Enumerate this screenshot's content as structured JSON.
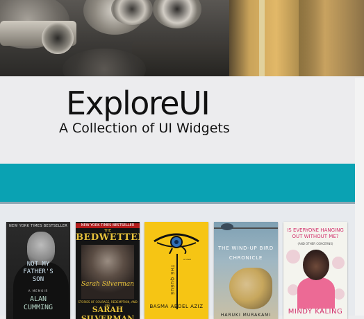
{
  "header": {
    "title": "ExploreUI",
    "subtitle": "A Collection of UI Widgets"
  },
  "books": [
    {
      "top_banner": "NEW YORK TIMES BESTSELLER",
      "title": "NOT MY\nFATHER'S\nSON",
      "kicker": "A MEMOIR",
      "author": "ALAN\nCUMMING"
    },
    {
      "top_banner": "NEW YORK TIMES BESTSELLER",
      "the": "THE",
      "title": "BEDWETTER",
      "signature": "Sarah Silverman",
      "subtitle": "STORIES OF COURAGE, REDEMPTION, AND PEE",
      "author": "SARAH SILVERMAN"
    },
    {
      "title": "THE QUEUE",
      "author": "BASMA ABDEL AZIZ",
      "blurb": "a novel"
    },
    {
      "the": "THE",
      "title": "WIND-UP BIRD",
      "title2": "CHRONICLE",
      "author": "HARUKI MURAKAMI"
    },
    {
      "title": "IS EVERYONE HANGING\nOUT WITHOUT ME?",
      "subtitle": "(AND OTHER CONCERNS)",
      "author": "MINDY KALING"
    }
  ],
  "colors": {
    "accent_band": "#0aa2b3",
    "background": "#ececee"
  }
}
